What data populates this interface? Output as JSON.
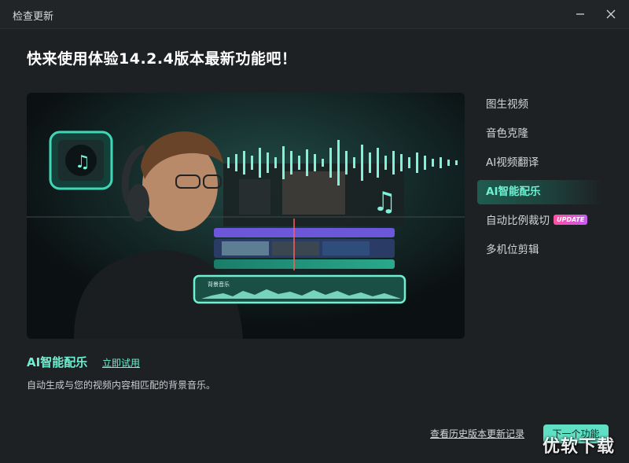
{
  "window": {
    "title": "检查更新"
  },
  "headline": "快来使用体验14.2.4版本最新功能吧！",
  "menu": {
    "items": [
      {
        "label": "图生视频",
        "active": false,
        "badge": ""
      },
      {
        "label": "音色克隆",
        "active": false,
        "badge": ""
      },
      {
        "label": "AI视频翻译",
        "active": false,
        "badge": ""
      },
      {
        "label": "AI智能配乐",
        "active": true,
        "badge": ""
      },
      {
        "label": "自动比例裁切",
        "active": false,
        "badge": "UPDATE"
      },
      {
        "label": "多机位剪辑",
        "active": false,
        "badge": ""
      }
    ]
  },
  "feature": {
    "title": "AI智能配乐",
    "try_label": "立即试用",
    "description": "自动生成与您的视频内容相匹配的背景音乐。"
  },
  "hero": {
    "clip_label": "背景音乐"
  },
  "footer": {
    "history_label": "查看历史版本更新记录",
    "next_label": "下一个功能"
  },
  "watermark": "优软下载",
  "colors": {
    "accent": "#6ff0d2",
    "background": "#1e2124",
    "button": "#5fe0c4"
  }
}
